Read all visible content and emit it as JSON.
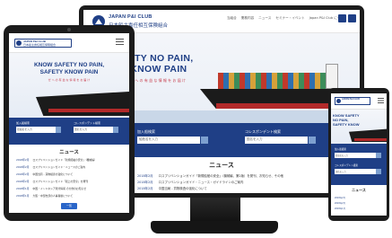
{
  "brand": {
    "name_en": "JAPAN P&I CLUB",
    "name_ja": "日本船主責任相互保険組合",
    "primary_color": "#1f3f86",
    "accent_color": "#c84050"
  },
  "desktop": {
    "nav": [
      "当組合",
      "業務内容",
      "ニュース",
      "セミナー・イベント",
      "Japan P&I Club について"
    ],
    "hero_title_line1": "OW SAFETY NO PAIN,",
    "hero_title_line2": "SAFETY KNOW PAIN",
    "hero_subtitle": "ぜ へ の 有 益 な 情 報 を お 届 け",
    "search": {
      "label1": "加入船検索",
      "placeholder1": "船舶名を入力",
      "label2": "コレスポンデント検索",
      "placeholder2": "国名を入力"
    },
    "news_heading": "ニュース",
    "news": [
      {
        "date": "2018年2月",
        "text": "ロスプリベンションガイド「新規船舶の安全」（機械編、第2版）を発刊、お知らせ、その他"
      },
      {
        "date": "2018年2月",
        "text": "ロスプリベンションガイド・ニュース・ガイドラインのご案内"
      },
      {
        "date": "2018年2月",
        "text": "中国当局 - 貨物検査の強化について"
      }
    ]
  },
  "tablet": {
    "logo_en": "JAPAN P&I CLUB",
    "logo_ja": "日本船主責任相互保険組合",
    "hero_title_line1": "KNOW SAFETY NO PAIN,",
    "hero_title_line2": "SAFETY KNOW PAIN",
    "hero_subtitle": "ぜ へ の 有 益 な 情 報 を お 届 け",
    "search": {
      "label1": "加入船検索",
      "placeholder1": "船舶名を入力",
      "label2": "コレスポンデント検索",
      "placeholder2": "国名を入力"
    },
    "news_heading": "ニュース",
    "news": [
      {
        "date": "2018年2月",
        "text": "ロスプリベンションガイド「新規船舶の安全」（機械編）"
      },
      {
        "date": "2018年2月",
        "text": "ロスプリベンションガイド・ニュースのご案内"
      },
      {
        "date": "2018年2月",
        "text": "中国当局 - 貨物検査の強化について"
      },
      {
        "date": "2018年2月",
        "text": "ロスプリベンションガイド「船上の安全」を発刊"
      },
      {
        "date": "2018年1月",
        "text": "中国・インドネシア港湾情報 その他のお知らせ"
      },
      {
        "date": "2018年1月",
        "text": "大阪・中部支部の人事異動について"
      }
    ],
    "more_label": "一覧"
  },
  "phone": {
    "logo_en": "JAPAN P&I CLUB",
    "hero_title_line1": "KNOW SAFETY",
    "hero_title_line2": "NO PAIN,",
    "hero_title_line3": "SAFETY KNOW",
    "search": {
      "label1": "加入船検索",
      "placeholder1": "船舶名を入力",
      "label2": "コレスポンデント検索",
      "placeholder2": "国名を入力"
    },
    "news_heading": "ニュース",
    "news": [
      {
        "date": "2018年2月",
        "text": ""
      },
      {
        "date": "2018年2月",
        "text": ""
      },
      {
        "date": "2018年1月",
        "text": ""
      }
    ]
  }
}
